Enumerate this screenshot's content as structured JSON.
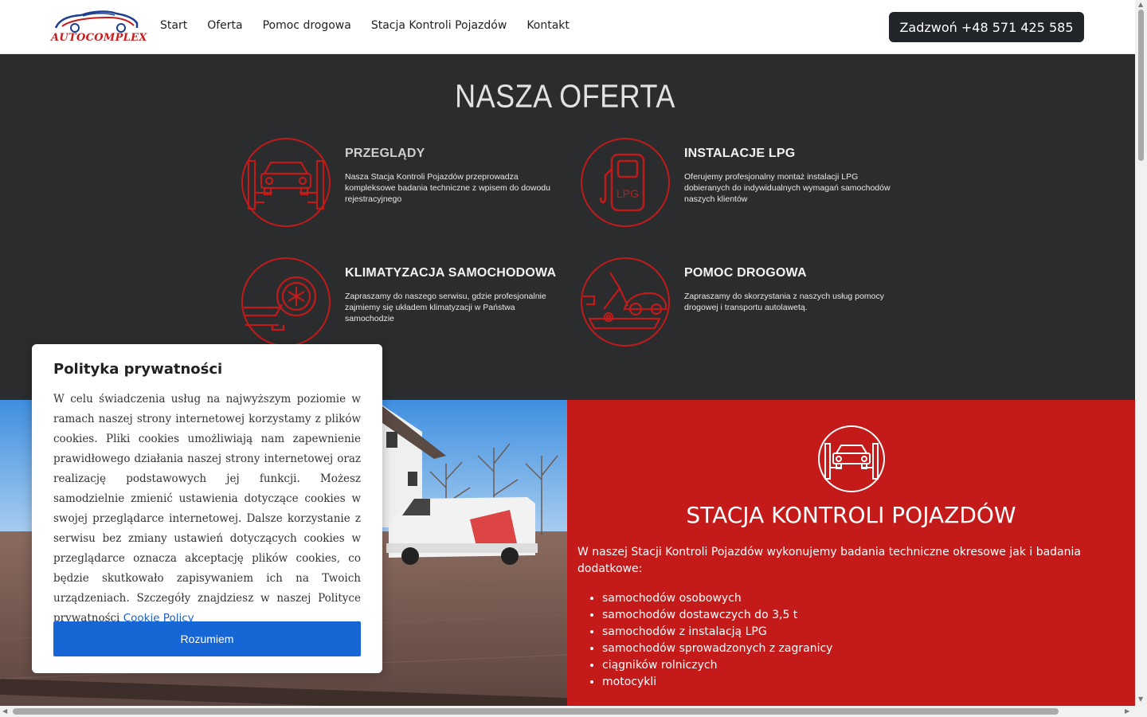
{
  "header": {
    "logo_text": "AUTOCOMPLEX",
    "nav": [
      "Start",
      "Oferta",
      "Pomoc drogowa",
      "Stacja Kontroli Pojazdów",
      "Kontakt"
    ],
    "call_label": "Zadzwoń +48 571 425 585"
  },
  "offer": {
    "title": "NASZA OFERTA",
    "services": [
      {
        "title": "PRZEGLĄDY",
        "desc": "Nasza Stacja Kontroli Pojazdów przeprowadza kompleksowe badania techniczne z wpisem do dowodu rejestracyjnego",
        "icon": "car-lift-icon"
      },
      {
        "title": "INSTALACJE LPG",
        "desc": "Oferujemy profesjonalny montaż instalacji LPG dobieranych do indywidualnych wymagań samochodów naszych klientów",
        "icon": "lpg-pump-icon",
        "icon_label": "LPG"
      },
      {
        "title": "KLIMATYZACJA SAMOCHODOWA",
        "desc": "Zapraszamy do naszego serwisu, gdzie profesjonalnie zajmiemy się układem klimatyzacji w Państwa samochodzie",
        "icon": "car-ac-snowflake-icon"
      },
      {
        "title": "POMOC DROGOWA",
        "desc": "Zapraszamy do skorzystania z naszych usług pomocy drogowej i transportu autolawetą.",
        "icon": "tow-truck-icon"
      }
    ]
  },
  "station": {
    "title": "STACJA KONTROLI POJAZDÓW",
    "intro": "W naszej Stacji Kontroli Pojazdów wykonujemy badania techniczne okresowe jak i badania dodatkowe:",
    "items": [
      "samochodów osobowych",
      "samochodów dostawczych do 3,5 t",
      "samochodów z instalacją LPG",
      "samochodów sprowadzonych z zagranicy",
      "ciągników rolniczych",
      "motocykli"
    ]
  },
  "cookie": {
    "title": "Polityka prywatności",
    "text": "W celu świadczenia usług na najwyższym poziomie w ramach naszej strony internetowej korzystamy z plików cookies. Pliki cookies umożliwiają nam zapewnienie prawidłowego działania naszej strony internetowej oraz realizację podstawowych jej funkcji. Możesz samodzielnie zmienić ustawienia dotyczące cookies w swojej przeglądarce internetowej. Dalsze korzystanie z serwisu bez zmiany ustawień dotyczących cookies w przeglądarce oznacza akceptację plików cookies, co będzie skutkowało zapisywaniem ich na Twoich urządzeniach. Szczegóły znajdziesz w naszej Polityce prywatności",
    "link_label": "Cookie Policy",
    "button_label": "Rozumiem"
  },
  "colors": {
    "brand_red": "#c41a1a",
    "dark_bg": "#2b2c2e",
    "accent_blue": "#1766d6",
    "navbar_button": "#212529"
  }
}
